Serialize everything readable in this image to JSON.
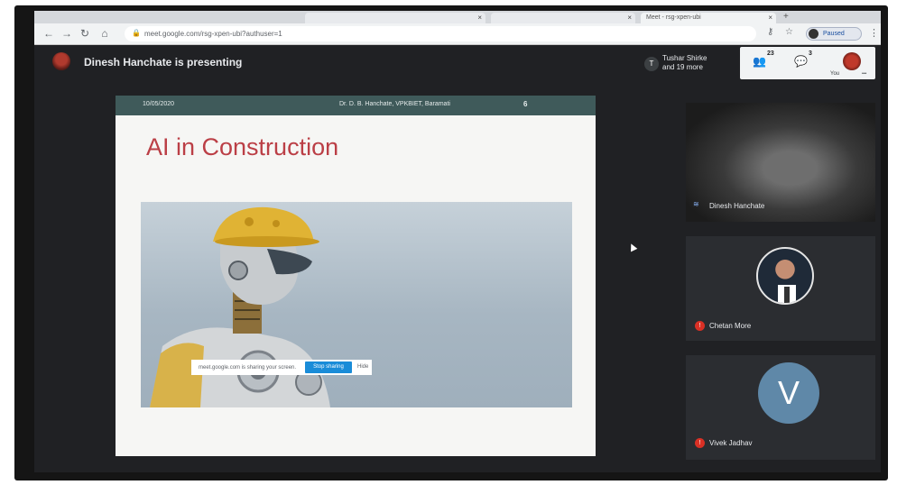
{
  "browser": {
    "tabs": [
      {
        "title": "",
        "active": false
      },
      {
        "title": "",
        "active": false
      },
      {
        "title": "Meet - rsg-xpen-ubi",
        "active": true
      }
    ],
    "url": "meet.google.com/rsg-xpen-ubi?authuser=1",
    "profile_label": "Paused"
  },
  "meet": {
    "presenting_text": "Dinesh Hanchate is presenting",
    "participants_initial": "T",
    "participants_text_line1": "Tushar Shirke",
    "participants_text_line2": "and 19 more",
    "people_count": "23",
    "chat_count": "3",
    "you_label": "You",
    "colors": {
      "background": "#202124",
      "mute": "#d93025",
      "stop_share": "#1a8cd8"
    }
  },
  "slide": {
    "date": "10/05/2020",
    "author": "Dr. D. B. Hanchate, VPKBIET, Baramati",
    "page_number": "6",
    "title": "AI in Construction",
    "image_alt": "robot-construction-worker"
  },
  "share_bar": {
    "text": "meet.google.com is sharing your screen.",
    "stop_label": "Stop sharing",
    "hide_label": "Hide"
  },
  "tiles": [
    {
      "name": "Dinesh Hanchate",
      "type": "video",
      "speaking": true
    },
    {
      "name": "Chetan More",
      "type": "photo",
      "muted": true
    },
    {
      "name": "Vivek Jadhav",
      "type": "letter",
      "initial": "V",
      "muted": true
    }
  ]
}
